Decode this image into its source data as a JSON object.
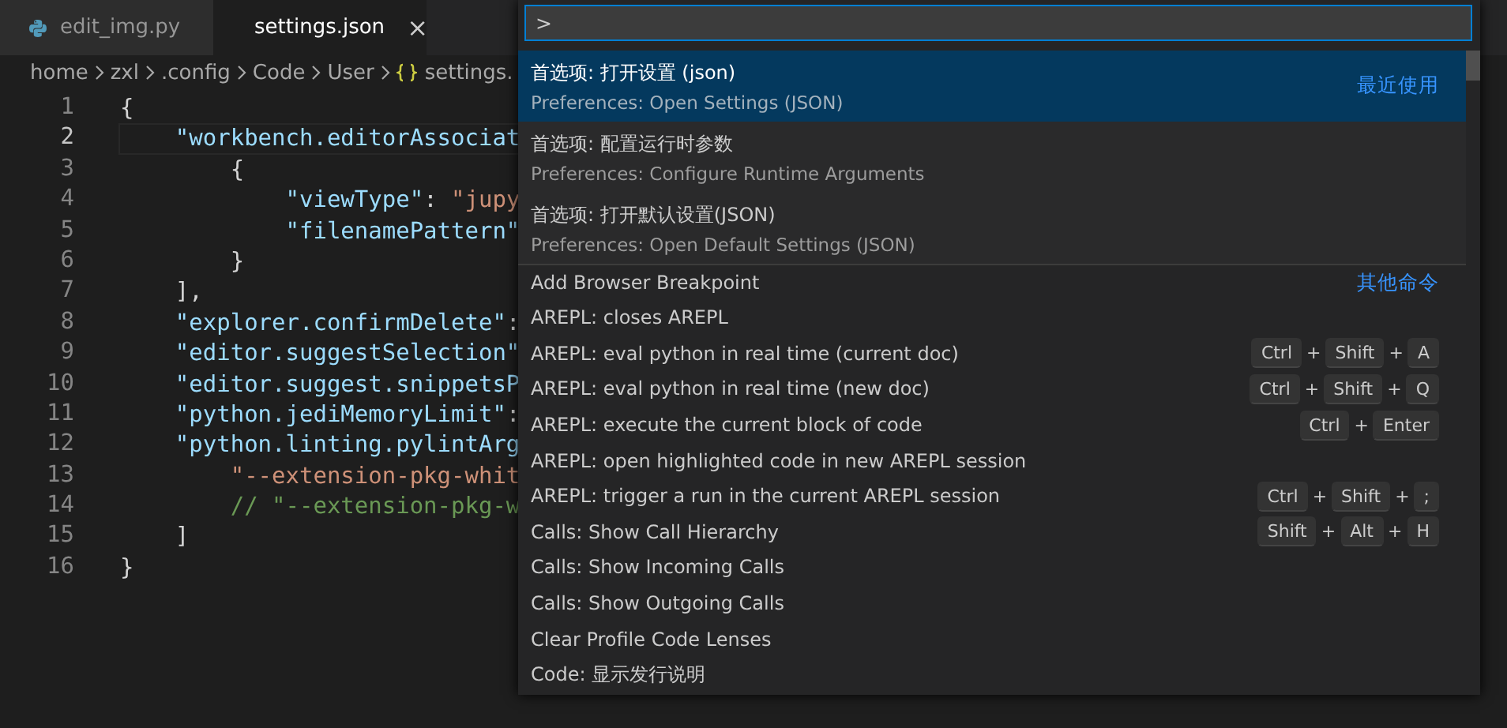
{
  "tabs": [
    {
      "label": "edit_img.py",
      "kind": "python",
      "selected": false
    },
    {
      "label": "settings.json",
      "kind": "json",
      "selected": true,
      "close": "×"
    }
  ],
  "breadcrumb": [
    {
      "label": "home"
    },
    {
      "label": "zxl"
    },
    {
      "label": ".config"
    },
    {
      "label": "Code"
    },
    {
      "label": "User"
    },
    {
      "label": "settings.",
      "kind": "json"
    }
  ],
  "editor": {
    "lines": [
      {
        "number": "1",
        "current": false,
        "tokens": [
          {
            "kind": "punct",
            "text": "{"
          }
        ]
      },
      {
        "number": "2",
        "current": true,
        "tokens": [
          {
            "kind": "key",
            "text": "    \"workbench.editorAssociat"
          }
        ]
      },
      {
        "number": "3",
        "current": false,
        "tokens": [
          {
            "kind": "punct",
            "text": "        {"
          }
        ]
      },
      {
        "number": "4",
        "current": false,
        "tokens": [
          {
            "kind": "key",
            "text": "            \"viewType\""
          },
          {
            "kind": "punct",
            "text": ": "
          },
          {
            "kind": "string",
            "text": "\"jupy"
          }
        ]
      },
      {
        "number": "5",
        "current": false,
        "tokens": [
          {
            "kind": "key",
            "text": "            \"filenamePattern\""
          }
        ]
      },
      {
        "number": "6",
        "current": false,
        "tokens": [
          {
            "kind": "punct",
            "text": "        }"
          }
        ]
      },
      {
        "number": "7",
        "current": false,
        "tokens": [
          {
            "kind": "punct",
            "text": "    ],"
          }
        ]
      },
      {
        "number": "8",
        "current": false,
        "tokens": [
          {
            "kind": "key",
            "text": "    \"explorer.confirmDelete\""
          },
          {
            "kind": "punct",
            "text": ":"
          }
        ]
      },
      {
        "number": "9",
        "current": false,
        "tokens": [
          {
            "kind": "key",
            "text": "    \"editor.suggestSelection\""
          }
        ]
      },
      {
        "number": "10",
        "current": false,
        "tokens": [
          {
            "kind": "key",
            "text": "    \"editor.suggest.snippetsP"
          }
        ]
      },
      {
        "number": "11",
        "current": false,
        "tokens": [
          {
            "kind": "key",
            "text": "    \"python.jediMemoryLimit\""
          },
          {
            "kind": "punct",
            "text": ":"
          }
        ]
      },
      {
        "number": "12",
        "current": false,
        "tokens": [
          {
            "kind": "key",
            "text": "    \"python.linting.pylintArg"
          }
        ]
      },
      {
        "number": "13",
        "current": false,
        "tokens": [
          {
            "kind": "string",
            "text": "        \"--extension-pkg-whit"
          }
        ]
      },
      {
        "number": "14",
        "current": false,
        "tokens": [
          {
            "kind": "comment",
            "text": "        // \"--extension-pkg-w"
          }
        ]
      },
      {
        "number": "15",
        "current": false,
        "tokens": [
          {
            "kind": "punct",
            "text": "    ]"
          }
        ]
      },
      {
        "number": "16",
        "current": false,
        "tokens": [
          {
            "kind": "punct",
            "text": "}"
          }
        ]
      }
    ]
  },
  "command_palette": {
    "input": {
      "value": ">"
    },
    "items": [
      {
        "kind": "double",
        "label": "首选项: 打开设置 (json)",
        "detail": "Preferences: Open Settings (JSON)",
        "tag": "最近使用",
        "selected": true
      },
      {
        "kind": "double",
        "label": "首选项: 配置运行时参数",
        "detail": "Preferences: Configure Runtime Arguments",
        "selected": false
      },
      {
        "kind": "double",
        "label": "首选项: 打开默认设置(JSON)",
        "detail": "Preferences: Open Default Settings (JSON)",
        "selected": false
      },
      {
        "kind": "single",
        "label": "Add Browser Breakpoint",
        "tag": "其他命令",
        "separator_above": true,
        "selected": false
      },
      {
        "kind": "single",
        "label": "AREPL: closes AREPL",
        "selected": false
      },
      {
        "kind": "single",
        "label": "AREPL: eval python in real time (current doc)",
        "selected": false,
        "keybinding": [
          {
            "kind": "key",
            "text": "Ctrl"
          },
          {
            "kind": "sep",
            "text": "+"
          },
          {
            "kind": "key",
            "text": "Shift"
          },
          {
            "kind": "sep",
            "text": "+"
          },
          {
            "kind": "key",
            "text": "A"
          }
        ]
      },
      {
        "kind": "single",
        "label": "AREPL: eval python in real time (new doc)",
        "selected": false,
        "keybinding": [
          {
            "kind": "key",
            "text": "Ctrl"
          },
          {
            "kind": "sep",
            "text": "+"
          },
          {
            "kind": "key",
            "text": "Shift"
          },
          {
            "kind": "sep",
            "text": "+"
          },
          {
            "kind": "key",
            "text": "Q"
          }
        ]
      },
      {
        "kind": "single",
        "label": "AREPL: execute the current block of code",
        "selected": false,
        "keybinding": [
          {
            "kind": "key",
            "text": "Ctrl"
          },
          {
            "kind": "sep",
            "text": "+"
          },
          {
            "kind": "key",
            "text": "Enter"
          }
        ]
      },
      {
        "kind": "single",
        "label": "AREPL: open highlighted code in new AREPL session",
        "selected": false
      },
      {
        "kind": "single",
        "label": "AREPL: trigger a run in the current AREPL session",
        "selected": false,
        "keybinding": [
          {
            "kind": "key",
            "text": "Ctrl"
          },
          {
            "kind": "sep",
            "text": "+"
          },
          {
            "kind": "key",
            "text": "Shift"
          },
          {
            "kind": "sep",
            "text": "+"
          },
          {
            "kind": "key",
            "text": ";"
          }
        ]
      },
      {
        "kind": "single",
        "label": "Calls: Show Call Hierarchy",
        "selected": false,
        "keybinding": [
          {
            "kind": "key",
            "text": "Shift"
          },
          {
            "kind": "sep",
            "text": "+"
          },
          {
            "kind": "key",
            "text": "Alt"
          },
          {
            "kind": "sep",
            "text": "+"
          },
          {
            "kind": "key",
            "text": "H"
          }
        ]
      },
      {
        "kind": "single",
        "label": "Calls: Show Incoming Calls",
        "selected": false
      },
      {
        "kind": "single",
        "label": "Calls: Show Outgoing Calls",
        "selected": false
      },
      {
        "kind": "single",
        "label": "Clear Profile Code Lenses",
        "selected": false
      },
      {
        "kind": "single",
        "label": "Code: 显示发行说明",
        "selected": false
      }
    ]
  }
}
